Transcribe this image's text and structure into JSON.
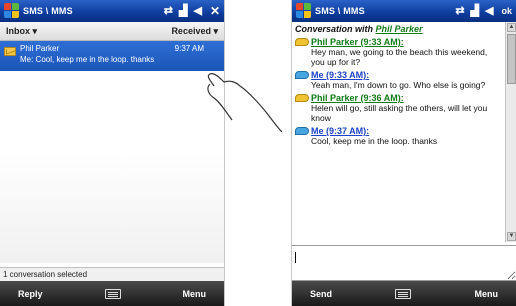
{
  "left": {
    "title": "SMS \\ MMS",
    "toolbar": {
      "folder": "Inbox",
      "sort": "Received"
    },
    "messages": [
      {
        "sender": "Phil Parker",
        "time": "9:37 AM",
        "preview": "Me: Cool, keep me in the loop. thanks"
      }
    ],
    "status": "1 conversation selected",
    "softkeys": {
      "left": "Reply",
      "right": "Menu"
    }
  },
  "right": {
    "title": "SMS \\ MMS",
    "ok_label": "ok",
    "conversation": {
      "heading_prefix": "Conversation with",
      "contact": "Phil Parker",
      "messages": [
        {
          "from": "Phil Parker (9:33 AM):",
          "text": "Hey man, we going to the beach this weekend, you up for it?"
        },
        {
          "from": "Me (9:33 AM):",
          "text": "Yeah man, I'm down to go. Who else is going?"
        },
        {
          "from": "Phil Parker (9:36 AM):",
          "text": "Helen will go, still asking the others, will let you know"
        },
        {
          "from": "Me (9:37 AM):",
          "text": "Cool, keep me in the loop. thanks"
        }
      ]
    },
    "compose_value": "",
    "softkeys": {
      "left": "Send",
      "right": "Menu"
    }
  }
}
